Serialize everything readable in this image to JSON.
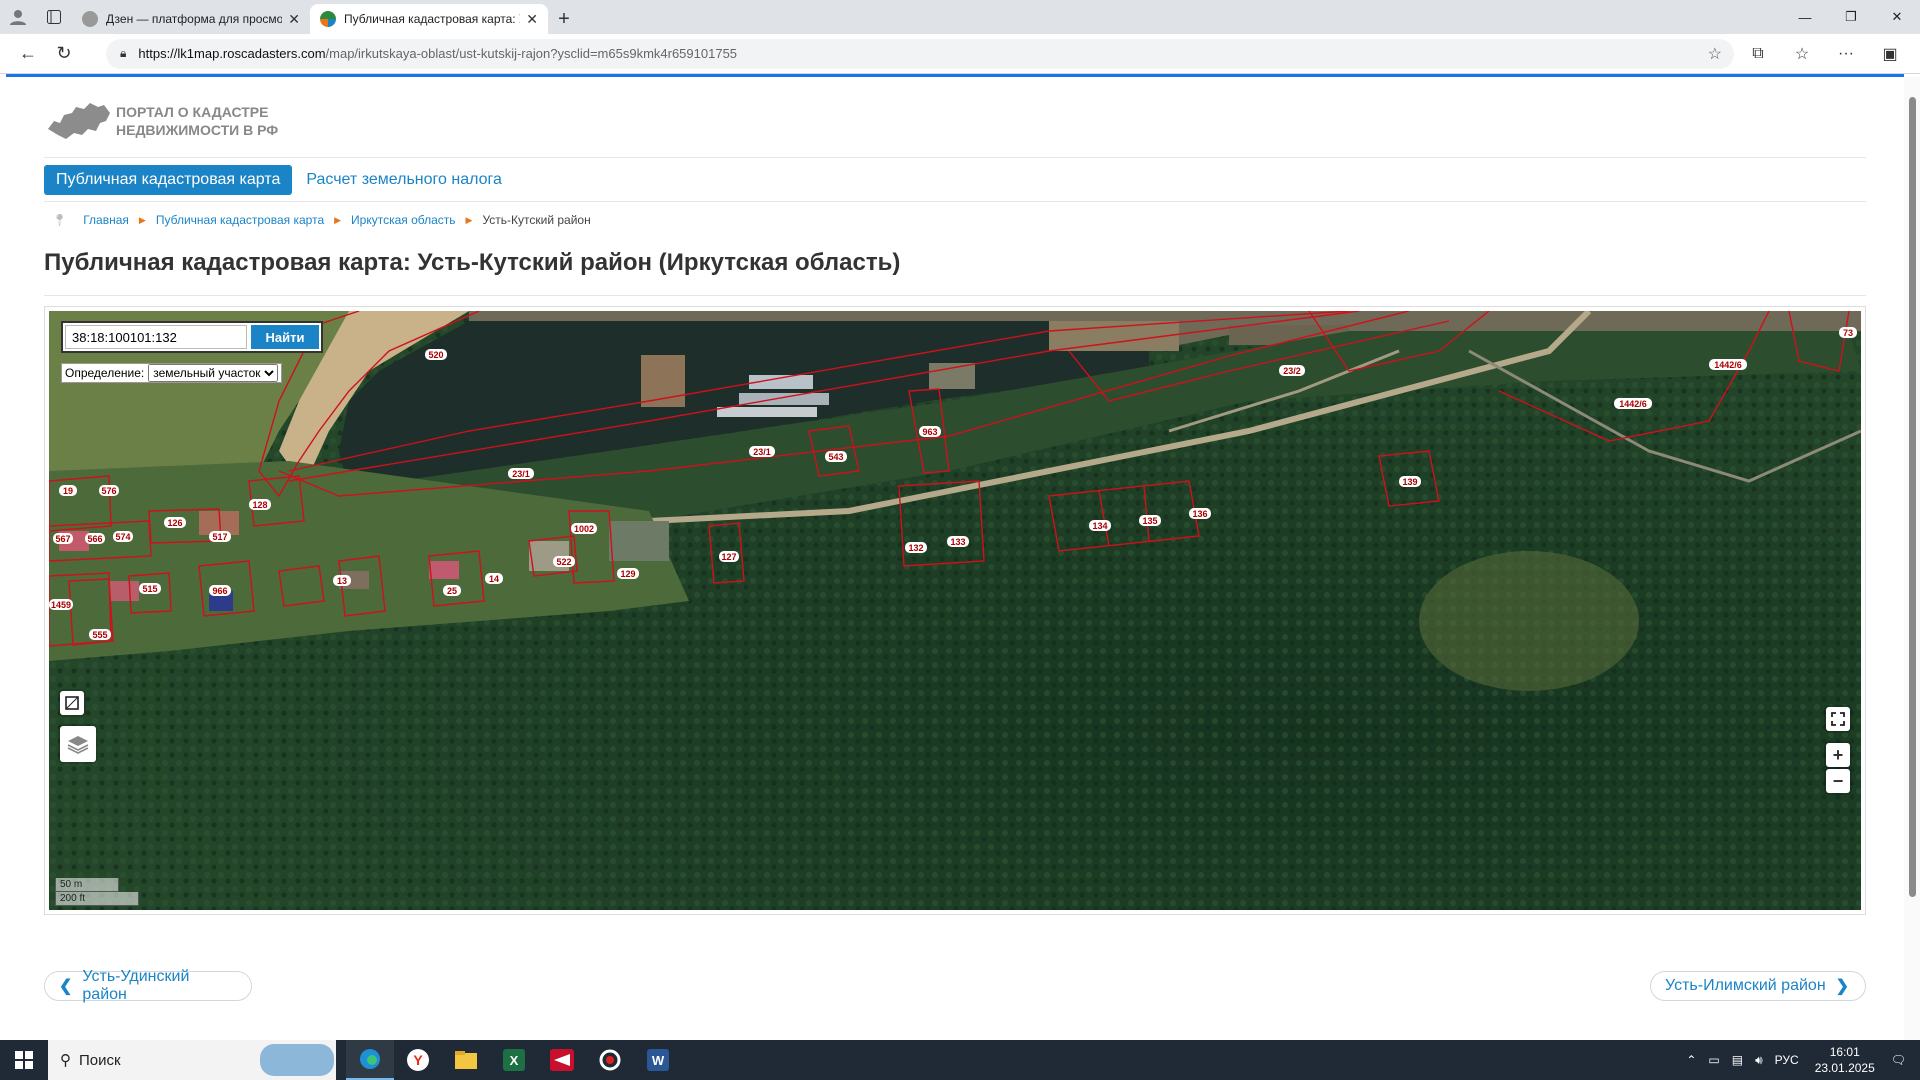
{
  "browser": {
    "tabs": [
      {
        "title": "Дзен — платформа для просмотра",
        "active": false
      },
      {
        "title": "Публичная кадастровая карта: У",
        "active": true
      }
    ],
    "url_host": "https://lk1map.roscadasters.com",
    "url_path": "/map/irkutskaya-oblast/ust-kutskij-rajon?ysclid=m65s9kmk4r659101755"
  },
  "portal": {
    "logo_line1": "ПОРТАЛ О КАДАСТРЕ",
    "logo_line2": "НЕДВИЖИМОСТИ В РФ"
  },
  "menu": {
    "active": "Публичная кадастровая карта",
    "other": "Расчет земельного налога"
  },
  "breadcrumb": {
    "home": "Главная",
    "map": "Публичная кадастровая карта",
    "region": "Иркутская область",
    "current": "Усть-Кутский район"
  },
  "page_title": "Публичная кадастровая карта: Усть-Кутский район (Иркутская область)",
  "map": {
    "search_value": "38:18:100101:132",
    "search_button": "Найти",
    "definition_label": "Определение:",
    "definition_value": "земельный участок",
    "scale_m": "50 m",
    "scale_ft": "200 ft",
    "zoom_in": "+",
    "zoom_out": "−",
    "parcels": [
      {
        "label": "520"
      },
      {
        "label": "23/2"
      },
      {
        "label": "1442/6"
      },
      {
        "label": "1442/6"
      },
      {
        "label": "23/1"
      },
      {
        "label": "23/1"
      },
      {
        "label": "543"
      },
      {
        "label": "963"
      },
      {
        "label": "139"
      },
      {
        "label": "19"
      },
      {
        "label": "576"
      },
      {
        "label": "128"
      },
      {
        "label": "567"
      },
      {
        "label": "566"
      },
      {
        "label": "574"
      },
      {
        "label": "126"
      },
      {
        "label": "517"
      },
      {
        "label": "1002"
      },
      {
        "label": "134"
      },
      {
        "label": "135"
      },
      {
        "label": "136"
      },
      {
        "label": "132"
      },
      {
        "label": "133"
      },
      {
        "label": "127"
      },
      {
        "label": "522"
      },
      {
        "label": "129"
      },
      {
        "label": "14"
      },
      {
        "label": "25"
      },
      {
        "label": "13"
      },
      {
        "label": "515"
      },
      {
        "label": "966"
      },
      {
        "label": "1459"
      },
      {
        "label": "555"
      },
      {
        "label": "73"
      }
    ]
  },
  "pager": {
    "prev": "Усть-Удинский район",
    "next": "Усть-Илимский район"
  },
  "taskbar": {
    "search": "Поиск",
    "lang": "РУС",
    "time": "16:01",
    "date": "23.01.2025"
  },
  "colors": {
    "accent": "#1b84c7",
    "parcel_line": "#d0101c",
    "forest": "#1f3a22"
  }
}
